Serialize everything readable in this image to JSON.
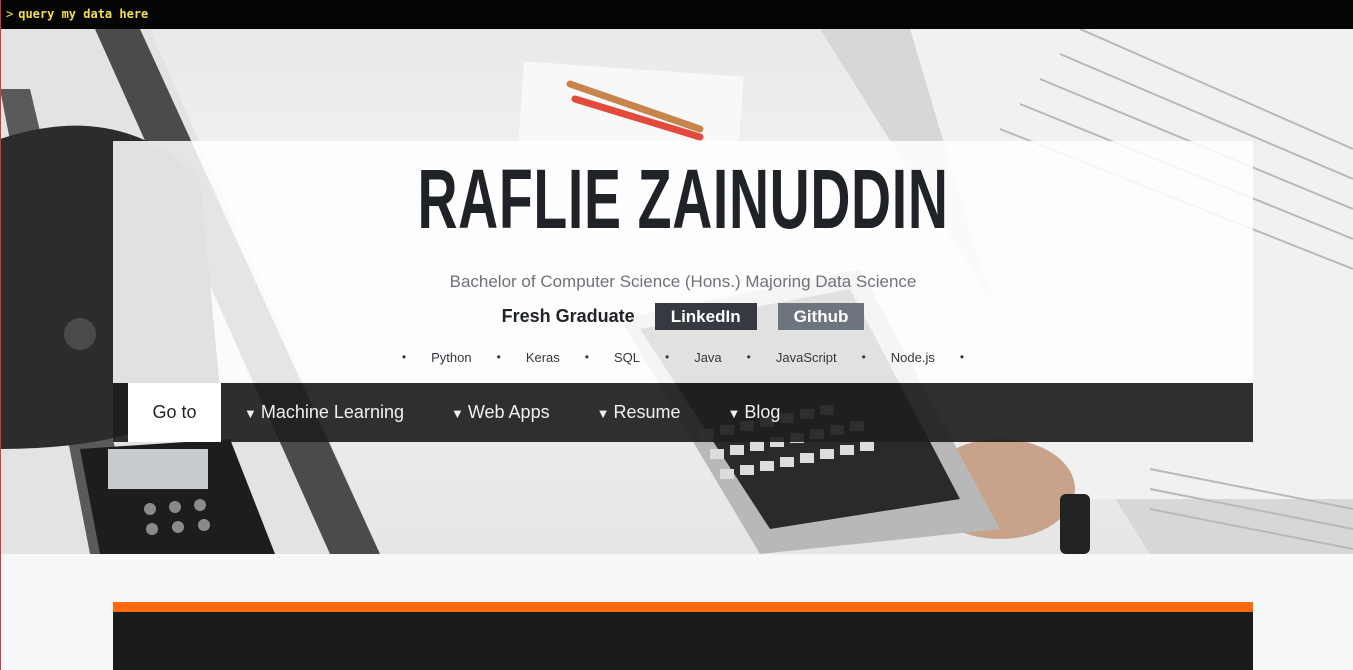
{
  "terminal": {
    "prompt": ">",
    "command": "query my data here"
  },
  "header": {
    "name": "RAFLIE ZAINUDDIN",
    "subtitle": "Bachelor of Computer Science (Hons.) Majoring Data Science",
    "status": "Fresh Graduate",
    "buttons": {
      "linkedin": "LinkedIn",
      "github": "Github"
    }
  },
  "skills": [
    "Python",
    "Keras",
    "SQL",
    "Java",
    "JavaScript",
    "Node.js"
  ],
  "skill_separator": "•",
  "nav": {
    "goto": "Go to",
    "caret": "▼",
    "items": [
      "Machine Learning",
      "Web Apps",
      "Resume",
      "Blog"
    ]
  },
  "colors": {
    "terminal_text": "#f5e04a",
    "linkedin_button": "#343a40",
    "github_button": "#6c757d",
    "accent_bar": "#ff6a0d",
    "nav_background": "#1e1e1e"
  }
}
